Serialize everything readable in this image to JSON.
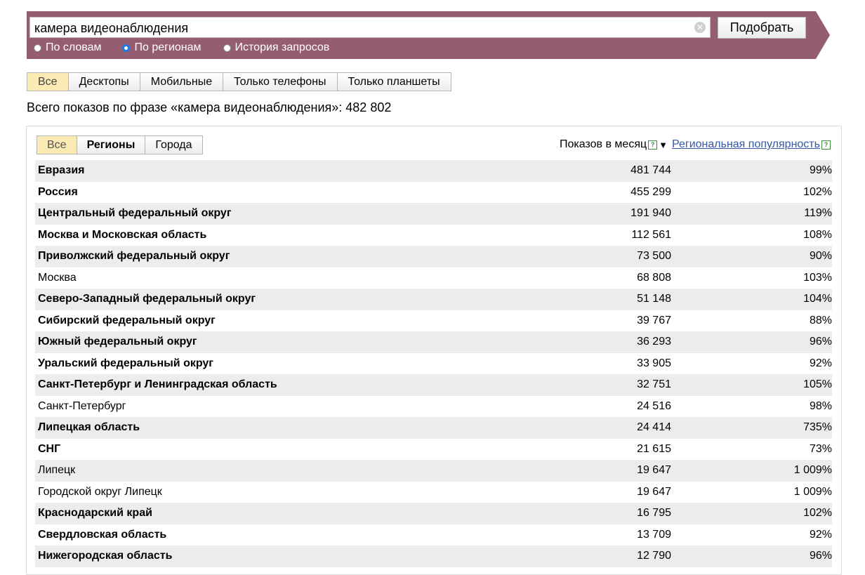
{
  "search": {
    "query": "камера видеонаблюдения",
    "button_label": "Подобрать",
    "clear_glyph": "✕",
    "modes": [
      {
        "label": "По словам",
        "checked": false
      },
      {
        "label": "По регионам",
        "checked": true
      },
      {
        "label": "История запросов",
        "checked": false
      }
    ]
  },
  "device_tabs": [
    {
      "label": "Все",
      "active": true
    },
    {
      "label": "Десктопы",
      "active": false
    },
    {
      "label": "Мобильные",
      "active": false
    },
    {
      "label": "Только телефоны",
      "active": false
    },
    {
      "label": "Только планшеты",
      "active": false
    }
  ],
  "total_line": "Всего показов по фразе «камера видеонаблюдения»: 482 802",
  "region_tabs": [
    {
      "label": "Все",
      "active": true,
      "bold": false
    },
    {
      "label": "Регионы",
      "active": false,
      "bold": true
    },
    {
      "label": "Города",
      "active": false,
      "bold": false
    }
  ],
  "columns": {
    "shows": "Показов в месяц",
    "popularity": "Региональная популярность",
    "help_glyph": "?",
    "sort_glyph": "▼"
  },
  "rows": [
    {
      "name": "Евразия",
      "shows": "481 744",
      "pop": "99%",
      "bold": true
    },
    {
      "name": "Россия",
      "shows": "455 299",
      "pop": "102%",
      "bold": true
    },
    {
      "name": "Центральный федеральный округ",
      "shows": "191 940",
      "pop": "119%",
      "bold": true
    },
    {
      "name": "Москва и Московская область",
      "shows": "112 561",
      "pop": "108%",
      "bold": true
    },
    {
      "name": "Приволжский федеральный округ",
      "shows": "73 500",
      "pop": "90%",
      "bold": true
    },
    {
      "name": "Москва",
      "shows": "68 808",
      "pop": "103%",
      "bold": false
    },
    {
      "name": "Северо-Западный федеральный округ",
      "shows": "51 148",
      "pop": "104%",
      "bold": true
    },
    {
      "name": "Сибирский федеральный округ",
      "shows": "39 767",
      "pop": "88%",
      "bold": true
    },
    {
      "name": "Южный федеральный округ",
      "shows": "36 293",
      "pop": "96%",
      "bold": true
    },
    {
      "name": "Уральский федеральный округ",
      "shows": "33 905",
      "pop": "92%",
      "bold": true
    },
    {
      "name": "Санкт-Петербург и Ленинградская область",
      "shows": "32 751",
      "pop": "105%",
      "bold": true
    },
    {
      "name": "Санкт-Петербург",
      "shows": "24 516",
      "pop": "98%",
      "bold": false
    },
    {
      "name": "Липецкая область",
      "shows": "24 414",
      "pop": "735%",
      "bold": true
    },
    {
      "name": "СНГ",
      "shows": "21 615",
      "pop": "73%",
      "bold": true
    },
    {
      "name": "Липецк",
      "shows": "19 647",
      "pop": "1 009%",
      "bold": false
    },
    {
      "name": "Городской округ Липецк",
      "shows": "19 647",
      "pop": "1 009%",
      "bold": false
    },
    {
      "name": "Краснодарский край",
      "shows": "16 795",
      "pop": "102%",
      "bold": true
    },
    {
      "name": "Свердловская область",
      "shows": "13 709",
      "pop": "92%",
      "bold": true
    },
    {
      "name": "Нижегородская область",
      "shows": "12 790",
      "pop": "96%",
      "bold": true
    }
  ],
  "colors": {
    "band": "#955d72",
    "active_tab": "#fbeab4",
    "link": "#3358a8",
    "row_stripe": "#ececec"
  }
}
